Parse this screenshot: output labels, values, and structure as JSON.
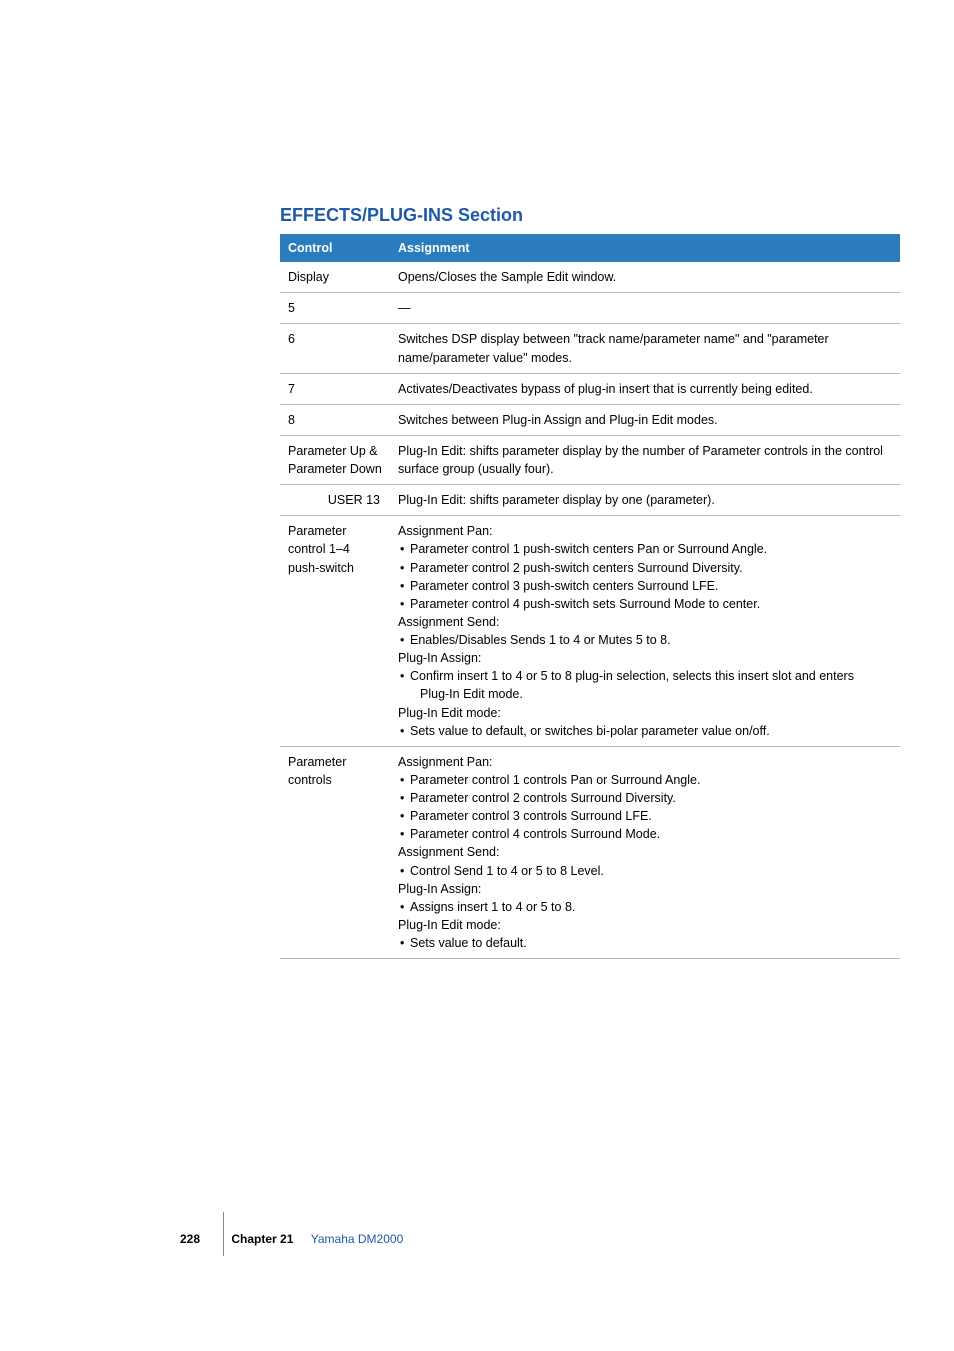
{
  "heading": "EFFECTS/PLUG-INS Section",
  "table": {
    "headers": {
      "control": "Control",
      "assignment": "Assignment"
    },
    "rows": [
      {
        "control": "Display",
        "assignment_text": "Opens/Closes the Sample Edit window."
      },
      {
        "control": "5",
        "assignment_text": "—"
      },
      {
        "control": "6",
        "assignment_text": "Switches DSP display between \"track name/parameter name\" and \"parameter name/parameter value\" modes."
      },
      {
        "control": "7",
        "assignment_text": "Activates/Deactivates bypass of plug-in insert that is currently being edited."
      },
      {
        "control": "8",
        "assignment_text": "Switches between Plug-in Assign and Plug-in Edit modes."
      },
      {
        "control": "Parameter Up & Parameter Down",
        "assignment_text": "Plug-In Edit:  shifts parameter display by the number of Parameter controls in the control surface group (usually four)."
      },
      {
        "control": "USER 13",
        "align": "right",
        "assignment_text": "Plug-In Edit:  shifts parameter display by one (parameter)."
      },
      {
        "control": "Parameter control 1–4 push-switch",
        "assignment_lines": [
          {
            "type": "plain",
            "text": "Assignment Pan:"
          },
          {
            "type": "bullet",
            "text": "Parameter control 1 push-switch centers Pan or Surround Angle."
          },
          {
            "type": "bullet",
            "text": "Parameter control 2 push-switch centers Surround Diversity."
          },
          {
            "type": "bullet",
            "text": "Parameter control 3 push-switch centers Surround LFE."
          },
          {
            "type": "bullet",
            "text": "Parameter control 4 push-switch sets Surround Mode to center."
          },
          {
            "type": "plain",
            "text": "Assignment Send:"
          },
          {
            "type": "bullet",
            "text": "Enables/Disables Sends 1 to 4 or Mutes 5 to 8."
          },
          {
            "type": "plain",
            "text": "Plug-In Assign:"
          },
          {
            "type": "bullet",
            "text": "Confirm insert 1 to 4 or 5 to 8 plug-in selection, selects this insert slot and enters"
          },
          {
            "type": "sub",
            "text": "Plug-In Edit mode."
          },
          {
            "type": "plain",
            "text": "Plug-In Edit mode:"
          },
          {
            "type": "bullet",
            "text": "Sets value to default, or switches bi-polar parameter value on/off."
          }
        ]
      },
      {
        "control": "Parameter controls",
        "assignment_lines": [
          {
            "type": "plain",
            "text": "Assignment Pan:"
          },
          {
            "type": "bullet",
            "text": "Parameter control 1 controls Pan or Surround Angle."
          },
          {
            "type": "bullet",
            "text": "Parameter control 2 controls Surround Diversity."
          },
          {
            "type": "bullet",
            "text": "Parameter control 3 controls Surround LFE."
          },
          {
            "type": "bullet",
            "text": "Parameter control 4 controls Surround Mode."
          },
          {
            "type": "plain",
            "text": "Assignment Send:"
          },
          {
            "type": "bullet",
            "text": "Control Send 1 to 4 or 5 to 8 Level."
          },
          {
            "type": "plain",
            "text": "Plug-In Assign:"
          },
          {
            "type": "bullet",
            "text": "Assigns insert 1 to 4 or 5 to 8."
          },
          {
            "type": "plain",
            "text": "Plug-In Edit mode:"
          },
          {
            "type": "bullet",
            "text": "Sets value to default."
          }
        ]
      }
    ]
  },
  "footer": {
    "page": "228",
    "chapter_label": "Chapter 21",
    "chapter_title": "Yamaha DM2000"
  }
}
